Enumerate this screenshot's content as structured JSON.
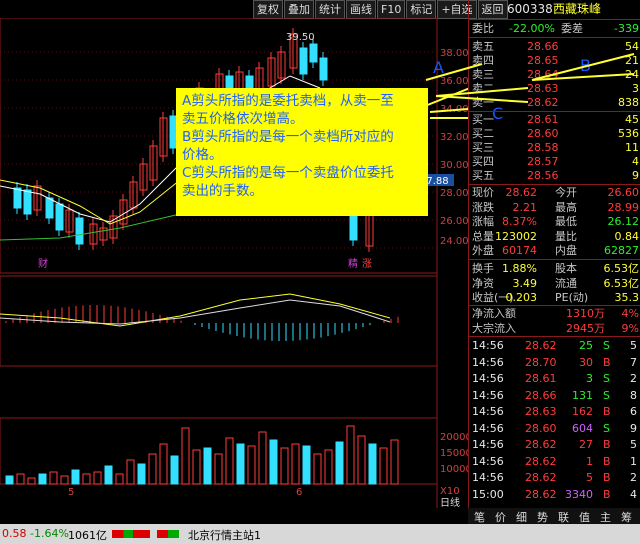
{
  "toolbar": [
    "复权",
    "叠加",
    "统计",
    "画线",
    "F10",
    "标记",
    "+自选",
    "返回"
  ],
  "price_axis": [
    "39.50",
    "38.00",
    "36.00",
    "34.00",
    "32.00",
    "30.00",
    "28.00",
    "26.00",
    "24.00"
  ],
  "price_highlight": "27.88",
  "high_label": "39.50",
  "markers": {
    "cai": "财",
    "jing": "精",
    "zhang": "涨"
  },
  "vol_axis": [
    "20000",
    "15000",
    "10000",
    "X10"
  ],
  "date_labels": [
    "5",
    "6"
  ],
  "lower_tab": "日线",
  "annotations": {
    "a_label": "A",
    "b_label": "B",
    "c_label": "C",
    "lines": [
      "A剪头所指的是委托卖档，从卖一至",
      "卖五价格依次增高。",
      "B剪头所指的是每一个卖档所对应的",
      "价格。",
      "C剪头所指的是每一个卖盘价位委托",
      "卖出的手数。"
    ]
  },
  "stock": {
    "code": "600338",
    "name": "西藏珠峰"
  },
  "weibi": {
    "label": "委比",
    "value": "-22.00%",
    "diff_label": "委差",
    "diff": "-339"
  },
  "sell": [
    {
      "label": "卖五",
      "price": "28.66",
      "vol": "54"
    },
    {
      "label": "卖四",
      "price": "28.65",
      "vol": "21"
    },
    {
      "label": "卖三",
      "price": "28.64",
      "vol": "24"
    },
    {
      "label": "卖二",
      "price": "28.63",
      "vol": "3"
    },
    {
      "label": "卖一",
      "price": "28.62",
      "vol": "838"
    }
  ],
  "buy": [
    {
      "label": "买一",
      "price": "28.61",
      "vol": "45"
    },
    {
      "label": "买二",
      "price": "28.60",
      "vol": "536"
    },
    {
      "label": "买三",
      "price": "28.58",
      "vol": "11"
    },
    {
      "label": "买四",
      "price": "28.57",
      "vol": "4"
    },
    {
      "label": "买五",
      "price": "28.56",
      "vol": "9"
    }
  ],
  "quote": [
    {
      "l1": "现价",
      "v1": "28.62",
      "c1": "red",
      "l2": "今开",
      "v2": "26.60",
      "c2": "red"
    },
    {
      "l1": "涨跌",
      "v1": "2.21",
      "c1": "red",
      "l2": "最高",
      "v2": "28.99",
      "c2": "red"
    },
    {
      "l1": "涨幅",
      "v1": "8.37%",
      "c1": "red",
      "l2": "最低",
      "v2": "26.12",
      "c2": "green"
    },
    {
      "l1": "总量",
      "v1": "123002",
      "c1": "yellow",
      "l2": "量比",
      "v2": "0.84",
      "c2": "yellow"
    },
    {
      "l1": "外盘",
      "v1": "60174",
      "c1": "red",
      "l2": "内盘",
      "v2": "62827",
      "c2": "green"
    }
  ],
  "stats": [
    {
      "l1": "换手",
      "v1": "1.88%",
      "l2": "股本",
      "v2": "6.53亿"
    },
    {
      "l1": "净资",
      "v1": "3.49",
      "l2": "流通",
      "v2": "6.53亿"
    },
    {
      "l1": "收益(一)",
      "v1": "0.203",
      "l2": "PE(动)",
      "v2": "35.3"
    }
  ],
  "flow": [
    {
      "label": "净流入额",
      "value": "1310万",
      "pct": "4%"
    },
    {
      "label": "大宗流入",
      "value": "2945万",
      "pct": "9%"
    }
  ],
  "ticks": [
    {
      "t": "14:56",
      "p": "28.62",
      "v": "25",
      "d": "S",
      "n": "5"
    },
    {
      "t": "14:56",
      "p": "28.70",
      "v": "30",
      "d": "B",
      "n": "7"
    },
    {
      "t": "14:56",
      "p": "28.61",
      "v": "3",
      "d": "S",
      "n": "2"
    },
    {
      "t": "14:56",
      "p": "28.66",
      "v": "131",
      "d": "S",
      "n": "8"
    },
    {
      "t": "14:56",
      "p": "28.63",
      "v": "162",
      "d": "B",
      "n": "6"
    },
    {
      "t": "14:56",
      "p": "28.60",
      "v": "604",
      "d": "S",
      "n": "9"
    },
    {
      "t": "14:56",
      "p": "28.62",
      "v": "27",
      "d": "B",
      "n": "5"
    },
    {
      "t": "14:56",
      "p": "28.62",
      "v": "1",
      "d": "B",
      "n": "1"
    },
    {
      "t": "14:56",
      "p": "28.62",
      "v": "5",
      "d": "B",
      "n": "2"
    },
    {
      "t": "15:00",
      "p": "28.62",
      "v": "3340",
      "d": "B",
      "n": "4"
    }
  ],
  "bottom_tabs": [
    "笔",
    "价",
    "细",
    "势",
    "联",
    "值",
    "主",
    "筹"
  ],
  "status": {
    "index_val": "0.58",
    "index_pct": "-1.64%",
    "index_amt": "1061亿",
    "server": "北京行情主站1"
  }
}
